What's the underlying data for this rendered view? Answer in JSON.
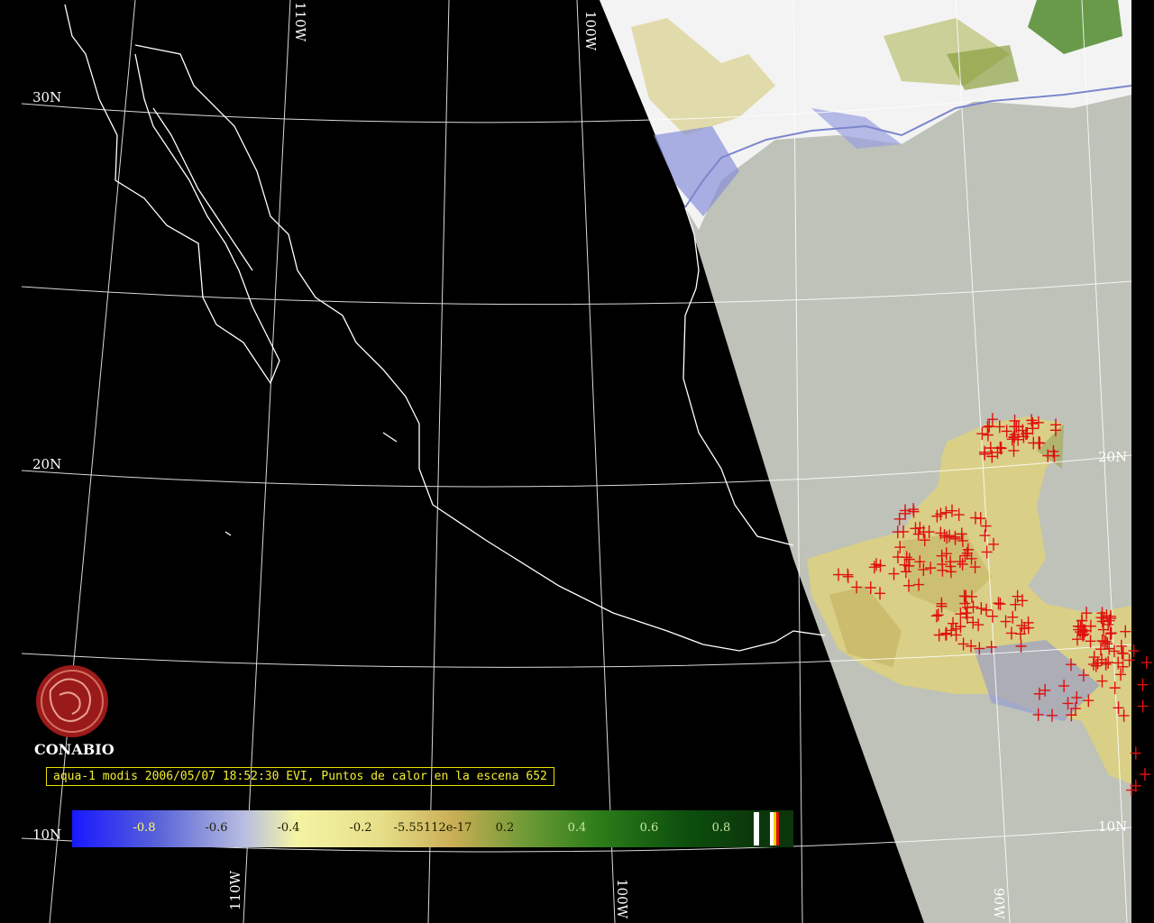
{
  "grid": {
    "lat_labels": [
      "30N",
      "20N",
      "10N",
      "20N",
      "10N"
    ],
    "lon_labels": [
      "110W",
      "100W",
      "110W",
      "100W",
      "90W"
    ]
  },
  "org": {
    "name": "CONABIO"
  },
  "caption": "aqua-1 modis 2006/05/07 18:52:30 EVI, Puntos de calor en la escena 652",
  "colorbar": {
    "ticks": [
      "-0.8",
      "-0.6",
      "-0.4",
      "-0.2",
      "-5.55112e-17",
      "0.2",
      "0.4",
      "0.6",
      "0.8"
    ]
  },
  "colors": {
    "background": "#000000",
    "ocean": "#bec2b8",
    "coastline": "#ffffff",
    "graticule": "#ffffff",
    "fire": "#e01010",
    "caption_text": "#f2ee30",
    "logo": "#9a1a1a"
  },
  "hotspots": {
    "count": 652
  }
}
